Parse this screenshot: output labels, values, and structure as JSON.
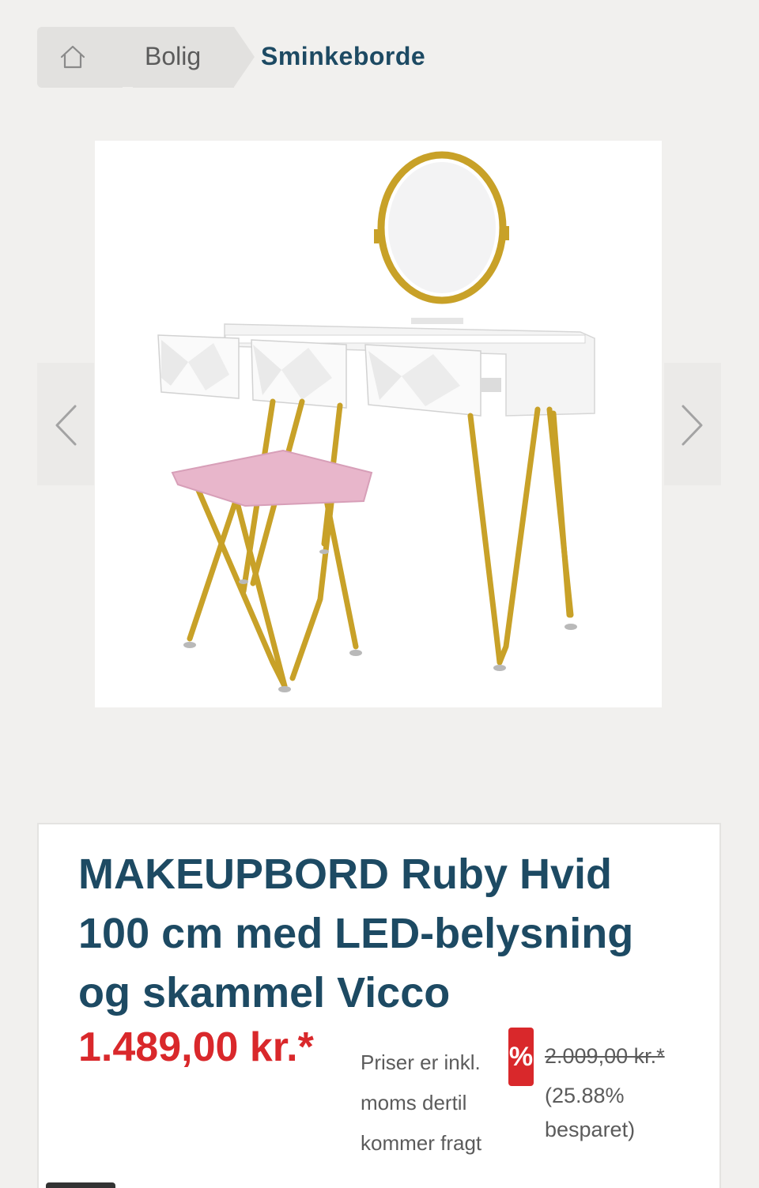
{
  "breadcrumb": {
    "home_icon": "home-icon",
    "items": [
      {
        "label": "Bolig"
      },
      {
        "label": "Sminkeborde"
      }
    ]
  },
  "gallery": {
    "prev_icon": "chevron-left-icon",
    "next_icon": "chevron-right-icon"
  },
  "product": {
    "title_brand": "MAKEUPBORD",
    "title_rest": " Ruby Hvid 100 cm med LED-belysning og skammel Vicco",
    "price": "1.489,00 kr.*",
    "price_note": "Priser er inkl. moms dertil kommer fragt",
    "sale_badge": "%",
    "old_price": "2.009,00 kr.*",
    "saved": "(25.88% besparet)"
  },
  "colors": {
    "primary": "#1d4a63",
    "sale": "#d9282b",
    "background": "#f1f0ee"
  }
}
